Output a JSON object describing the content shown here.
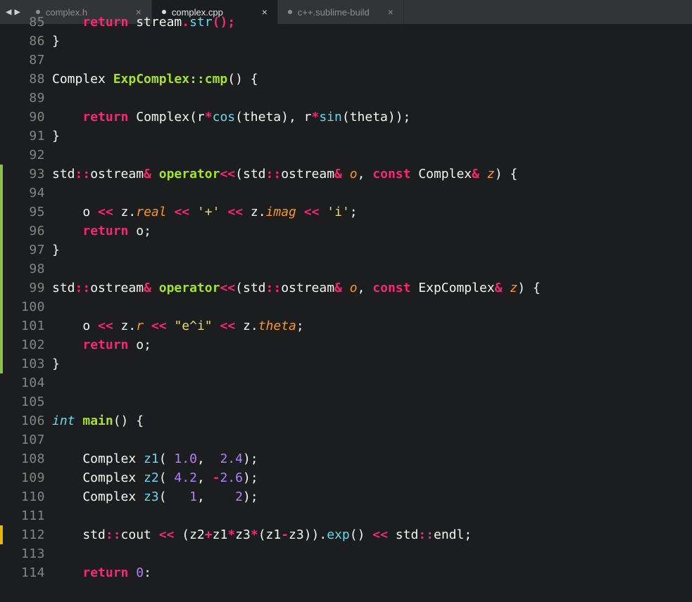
{
  "nav": {
    "back": "◀",
    "forward": "▶"
  },
  "tabs": [
    {
      "label": "complex.h",
      "active": false,
      "dirty": true
    },
    {
      "label": "complex.cpp",
      "active": true,
      "dirty": true
    },
    {
      "label": "c++.sublime-build",
      "active": false,
      "dirty": true
    }
  ],
  "first_line_number": 85,
  "change_marks": [
    {
      "from": 93,
      "to": 103,
      "kind": "green"
    },
    {
      "from": 112,
      "to": 112,
      "kind": "yellow"
    }
  ],
  "code_lines": [
    {
      "n": 85,
      "tokens": [
        [
          "kw",
          "    return"
        ],
        [
          "base",
          " "
        ],
        [
          "base",
          "stream"
        ],
        [
          "op",
          "."
        ],
        [
          "call",
          "str"
        ],
        [
          "op",
          "();"
        ]
      ],
      "cut_top": true
    },
    {
      "n": 86,
      "tokens": [
        [
          "base",
          "}"
        ]
      ]
    },
    {
      "n": 87,
      "tokens": []
    },
    {
      "n": 88,
      "tokens": [
        [
          "base",
          "Complex "
        ],
        [
          "def",
          "ExpComplex::cmp"
        ],
        [
          "base",
          "() {"
        ]
      ]
    },
    {
      "n": 89,
      "tokens": []
    },
    {
      "n": 90,
      "tokens": [
        [
          "base",
          "    "
        ],
        [
          "kw",
          "return"
        ],
        [
          "base",
          " Complex(r"
        ],
        [
          "op",
          "*"
        ],
        [
          "call",
          "cos"
        ],
        [
          "base",
          "(theta), r"
        ],
        [
          "op",
          "*"
        ],
        [
          "call",
          "sin"
        ],
        [
          "base",
          "(theta));"
        ]
      ]
    },
    {
      "n": 91,
      "tokens": [
        [
          "base",
          "}"
        ]
      ]
    },
    {
      "n": 92,
      "tokens": []
    },
    {
      "n": 93,
      "tokens": [
        [
          "base",
          "std"
        ],
        [
          "op",
          "::"
        ],
        [
          "base",
          "ostream"
        ],
        [
          "op",
          "& "
        ],
        [
          "def",
          "operator"
        ],
        [
          "op",
          "<<"
        ],
        [
          "base",
          "(std"
        ],
        [
          "op",
          "::"
        ],
        [
          "base",
          "ostream"
        ],
        [
          "op",
          "&"
        ],
        [
          "base",
          " "
        ],
        [
          "param",
          "o"
        ],
        [
          "base",
          ", "
        ],
        [
          "kw",
          "const"
        ],
        [
          "base",
          " Complex"
        ],
        [
          "op",
          "&"
        ],
        [
          "base",
          " "
        ],
        [
          "param",
          "z"
        ],
        [
          "base",
          ") {"
        ]
      ]
    },
    {
      "n": 94,
      "tokens": []
    },
    {
      "n": 95,
      "tokens": [
        [
          "base",
          "    o "
        ],
        [
          "op",
          "<<"
        ],
        [
          "base",
          " z."
        ],
        [
          "param",
          "real"
        ],
        [
          "base",
          " "
        ],
        [
          "op",
          "<<"
        ],
        [
          "base",
          " "
        ],
        [
          "str",
          "'+'"
        ],
        [
          "base",
          " "
        ],
        [
          "op",
          "<<"
        ],
        [
          "base",
          " z."
        ],
        [
          "param",
          "imag"
        ],
        [
          "base",
          " "
        ],
        [
          "op",
          "<<"
        ],
        [
          "base",
          " "
        ],
        [
          "str",
          "'i'"
        ],
        [
          "base",
          ";"
        ]
      ]
    },
    {
      "n": 96,
      "tokens": [
        [
          "base",
          "    "
        ],
        [
          "kw",
          "return"
        ],
        [
          "base",
          " o;"
        ]
      ]
    },
    {
      "n": 97,
      "tokens": [
        [
          "base",
          "}"
        ]
      ]
    },
    {
      "n": 98,
      "tokens": []
    },
    {
      "n": 99,
      "tokens": [
        [
          "base",
          "std"
        ],
        [
          "op",
          "::"
        ],
        [
          "base",
          "ostream"
        ],
        [
          "op",
          "& "
        ],
        [
          "def",
          "operator"
        ],
        [
          "op",
          "<<"
        ],
        [
          "base",
          "(std"
        ],
        [
          "op",
          "::"
        ],
        [
          "base",
          "ostream"
        ],
        [
          "op",
          "&"
        ],
        [
          "base",
          " "
        ],
        [
          "param",
          "o"
        ],
        [
          "base",
          ", "
        ],
        [
          "kw",
          "const"
        ],
        [
          "base",
          " ExpComplex"
        ],
        [
          "op",
          "&"
        ],
        [
          "base",
          " "
        ],
        [
          "param",
          "z"
        ],
        [
          "base",
          ") {"
        ]
      ]
    },
    {
      "n": 100,
      "tokens": []
    },
    {
      "n": 101,
      "tokens": [
        [
          "base",
          "    o "
        ],
        [
          "op",
          "<<"
        ],
        [
          "base",
          " z."
        ],
        [
          "param",
          "r"
        ],
        [
          "base",
          " "
        ],
        [
          "op",
          "<<"
        ],
        [
          "base",
          " "
        ],
        [
          "str",
          "\"e^i\""
        ],
        [
          "base",
          " "
        ],
        [
          "op",
          "<<"
        ],
        [
          "base",
          " z."
        ],
        [
          "param",
          "theta"
        ],
        [
          "base",
          ";"
        ]
      ]
    },
    {
      "n": 102,
      "tokens": [
        [
          "base",
          "    "
        ],
        [
          "kw",
          "return"
        ],
        [
          "base",
          " o;"
        ]
      ]
    },
    {
      "n": 103,
      "tokens": [
        [
          "base",
          "}"
        ]
      ]
    },
    {
      "n": 104,
      "tokens": []
    },
    {
      "n": 105,
      "tokens": []
    },
    {
      "n": 106,
      "tokens": [
        [
          "type",
          "int"
        ],
        [
          "base",
          " "
        ],
        [
          "def",
          "main"
        ],
        [
          "base",
          "() {"
        ]
      ]
    },
    {
      "n": 107,
      "tokens": []
    },
    {
      "n": 108,
      "tokens": [
        [
          "base",
          "    Complex "
        ],
        [
          "call",
          "z1"
        ],
        [
          "base",
          "( "
        ],
        [
          "num",
          "1.0"
        ],
        [
          "base",
          ",  "
        ],
        [
          "num",
          "2.4"
        ],
        [
          "base",
          ");"
        ]
      ]
    },
    {
      "n": 109,
      "tokens": [
        [
          "base",
          "    Complex "
        ],
        [
          "call",
          "z2"
        ],
        [
          "base",
          "( "
        ],
        [
          "num",
          "4.2"
        ],
        [
          "base",
          ", "
        ],
        [
          "op",
          "-"
        ],
        [
          "num",
          "2.6"
        ],
        [
          "base",
          ");"
        ]
      ]
    },
    {
      "n": 110,
      "tokens": [
        [
          "base",
          "    Complex "
        ],
        [
          "call",
          "z3"
        ],
        [
          "base",
          "(   "
        ],
        [
          "num",
          "1"
        ],
        [
          "base",
          ",    "
        ],
        [
          "num",
          "2"
        ],
        [
          "base",
          ");"
        ]
      ]
    },
    {
      "n": 111,
      "tokens": []
    },
    {
      "n": 112,
      "tokens": [
        [
          "base",
          "    std"
        ],
        [
          "op",
          "::"
        ],
        [
          "base",
          "cout "
        ],
        [
          "op",
          "<<"
        ],
        [
          "base",
          " (z2"
        ],
        [
          "op",
          "+"
        ],
        [
          "base",
          "z1"
        ],
        [
          "op",
          "*"
        ],
        [
          "base",
          "z3"
        ],
        [
          "op",
          "*"
        ],
        [
          "base",
          "(z1"
        ],
        [
          "op",
          "-"
        ],
        [
          "base",
          "z3))."
        ],
        [
          "call",
          "exp"
        ],
        [
          "base",
          "() "
        ],
        [
          "op",
          "<<"
        ],
        [
          "base",
          " std"
        ],
        [
          "op",
          "::"
        ],
        [
          "base",
          "endl;"
        ]
      ]
    },
    {
      "n": 113,
      "tokens": []
    },
    {
      "n": 114,
      "tokens": [
        [
          "base",
          "    "
        ],
        [
          "kw",
          "return"
        ],
        [
          "base",
          " "
        ],
        [
          "num",
          "0"
        ],
        [
          "base",
          ":"
        ]
      ],
      "cut_bottom": true
    }
  ]
}
